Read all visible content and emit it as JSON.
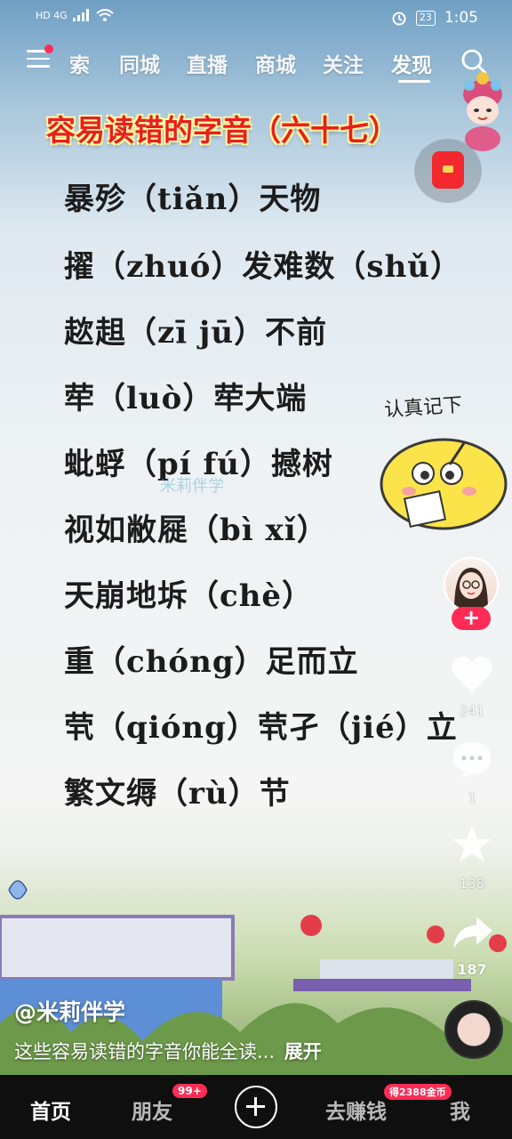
{
  "status_bar": {
    "left": "HD 4G",
    "battery": "23",
    "time": "1:05"
  },
  "top_nav": {
    "tabs": [
      {
        "label": "索"
      },
      {
        "label": "同城"
      },
      {
        "label": "直播"
      },
      {
        "label": "商城"
      },
      {
        "label": "关注"
      },
      {
        "label": "发现"
      }
    ],
    "active_tab": "发现"
  },
  "video": {
    "title": "容易读错的字音（六十七）",
    "lines": [
      "暴殄（tiǎn）天物",
      "擢（zhuó）发难数（shǔ）",
      "趑趄（zī jū）不前",
      "荦（luò）荦大端",
      "蚍蜉（pí fú）撼树",
      "视如敝屣（bì xǐ）",
      "天崩地坼（chè）",
      "重（chóng）足而立",
      "茕（qióng）茕孑（jié）立",
      "繁文缛（rù）节"
    ],
    "watermark": "米莉伴学",
    "sticker_caption": "认真记下"
  },
  "side_actions": {
    "likes": "241",
    "comments": "1",
    "favorites": "138",
    "shares": "187",
    "follow_symbol": "+"
  },
  "post": {
    "author": "@米莉伴学",
    "description": "这些容易读错的字音你能全读...",
    "expand": "展开"
  },
  "bottom_nav": {
    "home": "首页",
    "friends": "朋友",
    "friends_badge": "99+",
    "earn": "去赚钱",
    "earn_badge": "得2388金币",
    "me": "我"
  },
  "colors": {
    "accent": "#fe2c55",
    "title_red": "#e81f1f",
    "bottom_bar": "#0f0f0f"
  }
}
